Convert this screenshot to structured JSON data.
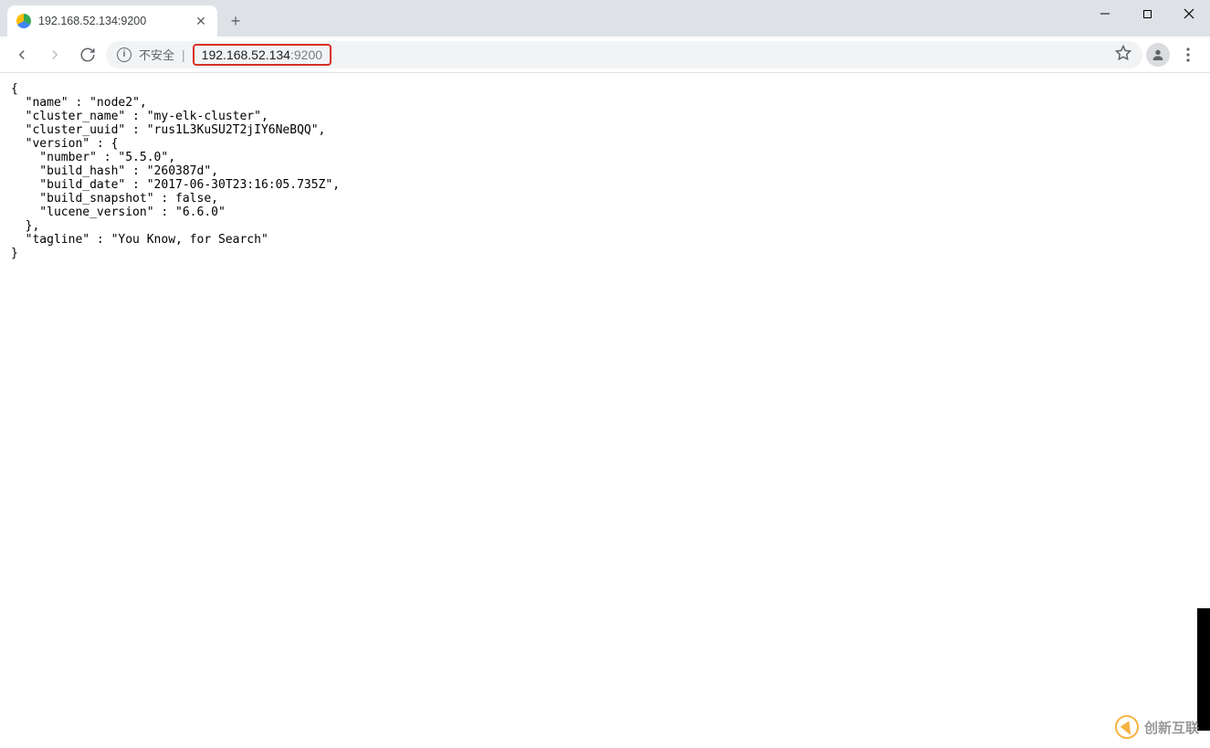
{
  "tab": {
    "title": "192.168.52.134:9200"
  },
  "toolbar": {
    "insecure_label": "不安全",
    "url_host": "192.168.52.134",
    "url_port": ":9200"
  },
  "response": {
    "name": "node2",
    "cluster_name": "my-elk-cluster",
    "cluster_uuid": "rus1L3KuSU2T2jIY6NeBQQ",
    "version": {
      "number": "5.5.0",
      "build_hash": "260387d",
      "build_date": "2017-06-30T23:16:05.735Z",
      "build_snapshot": "false",
      "lucene_version": "6.6.0"
    },
    "tagline": "You Know, for Search"
  },
  "watermark": {
    "text": "创新互联"
  }
}
